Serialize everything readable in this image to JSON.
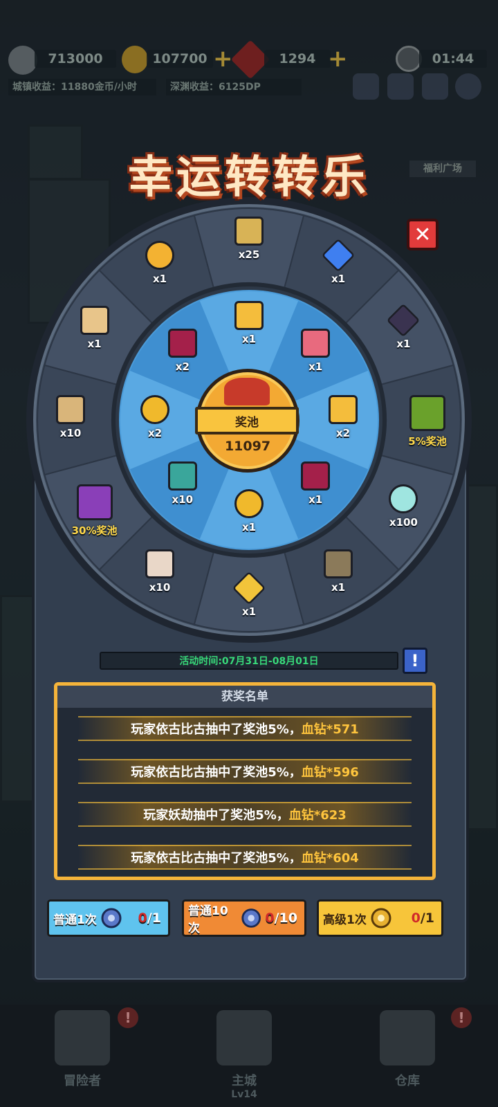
{
  "hud": {
    "power": "713000",
    "gold": "107700",
    "gems": "1294",
    "timer": "01:44",
    "city_income": "城镇收益：11880金币/小时",
    "abyss_income": "深渊收益：6125DP",
    "side_label": "福利广场"
  },
  "title": "幸运转转乐",
  "pool": {
    "label": "奖池",
    "value": "11097"
  },
  "outer_ring": [
    {
      "icon": "gold-crate-icon",
      "qty": "x25"
    },
    {
      "icon": "blue-crystal-icon",
      "qty": "x1"
    },
    {
      "icon": "dark-gem-icon",
      "qty": "x1"
    },
    {
      "icon": "green-chest-icon",
      "qty": "5%奖池"
    },
    {
      "icon": "rainbow-orb-icon",
      "qty": "x100"
    },
    {
      "icon": "scroll-roll-icon",
      "qty": "x1"
    },
    {
      "icon": "gold-ticket-icon",
      "qty": "x1"
    },
    {
      "icon": "potion-bottle-icon",
      "qty": "x10"
    },
    {
      "icon": "purple-chest-icon",
      "qty": "30%奖池"
    },
    {
      "icon": "parchment-icon",
      "qty": "x10"
    },
    {
      "icon": "tag-icon",
      "qty": "x1"
    },
    {
      "icon": "gold-flower-icon",
      "qty": "x1"
    }
  ],
  "inner_ring": [
    {
      "icon": "gold-boot-icon",
      "qty": "x1"
    },
    {
      "icon": "potion-set-icon",
      "qty": "x1"
    },
    {
      "icon": "gold-boot-icon",
      "qty": "x2"
    },
    {
      "icon": "red-envelope-icon",
      "qty": "x1"
    },
    {
      "icon": "gold-coin-icon",
      "qty": "x1"
    },
    {
      "icon": "green-envelope-icon",
      "qty": "x10"
    },
    {
      "icon": "gold-coin-icon",
      "qty": "x2"
    },
    {
      "icon": "red-envelope-icon",
      "qty": "x2"
    }
  ],
  "event_time": "活动时间:07月31日-08月01日",
  "info_button": "!",
  "winners": {
    "title": "获奖名单",
    "rows": [
      {
        "text": "玩家依古比古抽中了奖池5%，",
        "reward": "血钻*571"
      },
      {
        "text": "玩家依古比古抽中了奖池5%，",
        "reward": "血钻*596"
      },
      {
        "text": "玩家妖劫抽中了奖池5%，",
        "reward": "血钻*623"
      },
      {
        "text": "玩家依古比古抽中了奖池5%，",
        "reward": "血钻*604"
      }
    ]
  },
  "spin_buttons": [
    {
      "label": "普通1次",
      "used": "0",
      "total": "/1",
      "color": "#5fc3ee"
    },
    {
      "label": "普通10次",
      "used": "0",
      "total": "/10",
      "color": "#f08a35"
    },
    {
      "label": "高级1次",
      "used": "0",
      "total": "/1",
      "color": "#f7c53a"
    }
  ],
  "nav": {
    "adventurer": "冒险者",
    "main_city": "主城",
    "main_city_level": "Lv14",
    "warehouse": "仓库",
    "badge": "!"
  },
  "colors": {
    "wheel_outer": "#3e4b5d",
    "wheel_inner": "#4a9bd9",
    "pool": "#f3a933",
    "frame_gold": "#f5b43a",
    "reward_gold": "#ffc53d",
    "time_green": "#38d97a"
  }
}
